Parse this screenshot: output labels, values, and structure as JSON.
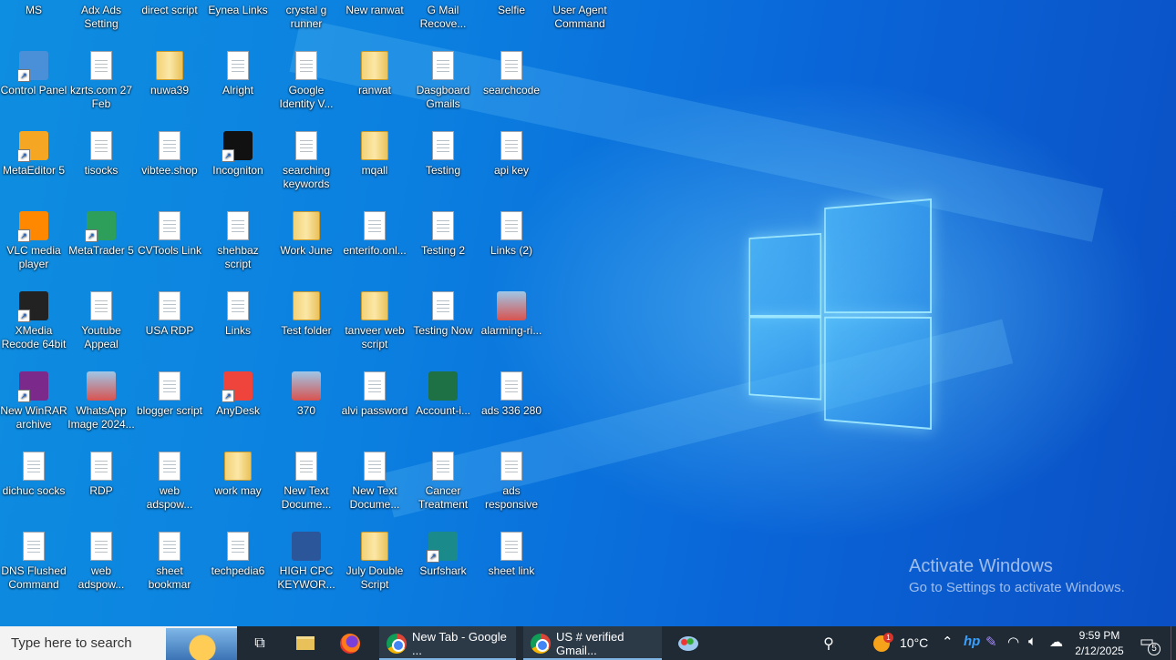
{
  "desktop_icons": [
    {
      "label": "MS",
      "type": "app"
    },
    {
      "label": "Adx Ads Setting",
      "type": "txt"
    },
    {
      "label": "direct script",
      "type": "txt"
    },
    {
      "label": "Eynea Links",
      "type": "txt"
    },
    {
      "label": "crystal g runner",
      "type": "txt"
    },
    {
      "label": "New ranwat",
      "type": "txt"
    },
    {
      "label": "G Mail Recove...",
      "type": "txt"
    },
    {
      "label": "Selfie",
      "type": "txt"
    },
    {
      "label": "User Agent Command",
      "type": "txt"
    },
    {
      "label": "Control Panel",
      "type": "app"
    },
    {
      "label": "kzrts.com 27 Feb",
      "type": "txt"
    },
    {
      "label": "nuwa39",
      "type": "folder"
    },
    {
      "label": "Alright",
      "type": "txt"
    },
    {
      "label": "Google Identity V...",
      "type": "txt"
    },
    {
      "label": "ranwat",
      "type": "folder"
    },
    {
      "label": "Dasgboard Gmails",
      "type": "txt"
    },
    {
      "label": "searchcode",
      "type": "txt"
    },
    {
      "label": "MetaEditor 5",
      "type": "app"
    },
    {
      "label": "tisocks",
      "type": "txt"
    },
    {
      "label": "vibtee.shop",
      "type": "txt"
    },
    {
      "label": "Incogniton",
      "type": "app"
    },
    {
      "label": "searching keywords",
      "type": "txt"
    },
    {
      "label": "mqall",
      "type": "folder"
    },
    {
      "label": "Testing",
      "type": "txt"
    },
    {
      "label": "api key",
      "type": "txt"
    },
    {
      "label": "VLC media player",
      "type": "app"
    },
    {
      "label": "MetaTrader 5",
      "type": "app"
    },
    {
      "label": "CVTools Link",
      "type": "txt"
    },
    {
      "label": "shehbaz script",
      "type": "txt"
    },
    {
      "label": "Work June",
      "type": "folder"
    },
    {
      "label": "enterifo.onl...",
      "type": "txt"
    },
    {
      "label": "Testing 2",
      "type": "txt"
    },
    {
      "label": "Links (2)",
      "type": "txt"
    },
    {
      "label": "XMedia Recode 64bit",
      "type": "app"
    },
    {
      "label": "Youtube Appeal",
      "type": "txt"
    },
    {
      "label": "USA RDP",
      "type": "txt"
    },
    {
      "label": "Links",
      "type": "txt"
    },
    {
      "label": "Test folder",
      "type": "folder"
    },
    {
      "label": "tanveer web script",
      "type": "folder"
    },
    {
      "label": "Testing Now",
      "type": "txt"
    },
    {
      "label": "alarming-ri...",
      "type": "image"
    },
    {
      "label": "New WinRAR archive",
      "type": "app"
    },
    {
      "label": "WhatsApp Image 2024...",
      "type": "image"
    },
    {
      "label": "blogger script",
      "type": "txt"
    },
    {
      "label": "AnyDesk",
      "type": "app"
    },
    {
      "label": "370",
      "type": "image"
    },
    {
      "label": "alvi password",
      "type": "txt"
    },
    {
      "label": "Account-i...",
      "type": "excel"
    },
    {
      "label": "ads 336 280",
      "type": "txt"
    },
    {
      "label": "dichuc socks",
      "type": "txt"
    },
    {
      "label": "RDP",
      "type": "txt"
    },
    {
      "label": "web adspow...",
      "type": "txt"
    },
    {
      "label": "work may",
      "type": "folder"
    },
    {
      "label": "New Text Docume...",
      "type": "txt"
    },
    {
      "label": "New Text Docume...",
      "type": "txt"
    },
    {
      "label": "Cancer Treatment",
      "type": "txt"
    },
    {
      "label": "ads responsive",
      "type": "txt"
    },
    {
      "label": "DNS Flushed Command",
      "type": "txt"
    },
    {
      "label": "web adspow...",
      "type": "txt"
    },
    {
      "label": "sheet bookmar",
      "type": "txt"
    },
    {
      "label": "techpedia6",
      "type": "txt"
    },
    {
      "label": "HIGH CPC KEYWOR...",
      "type": "word"
    },
    {
      "label": "July Double Script",
      "type": "folder"
    },
    {
      "label": "Surfshark",
      "type": "app"
    },
    {
      "label": "sheet link",
      "type": "txt"
    }
  ],
  "watermark": {
    "title": "Activate Windows",
    "subtitle": "Go to Settings to activate Windows."
  },
  "taskbar": {
    "search_placeholder": "Type here to search",
    "apps": [
      {
        "label": "New Tab - Google ...",
        "icon": "chrome-icon"
      },
      {
        "label": "US # verified Gmail...",
        "icon": "chrome-profile-icon"
      }
    ],
    "weather": {
      "temp": "10°C",
      "badge": "1"
    },
    "clock": {
      "time": "9:59 PM",
      "date": "2/12/2025"
    },
    "notification_count": "5"
  }
}
